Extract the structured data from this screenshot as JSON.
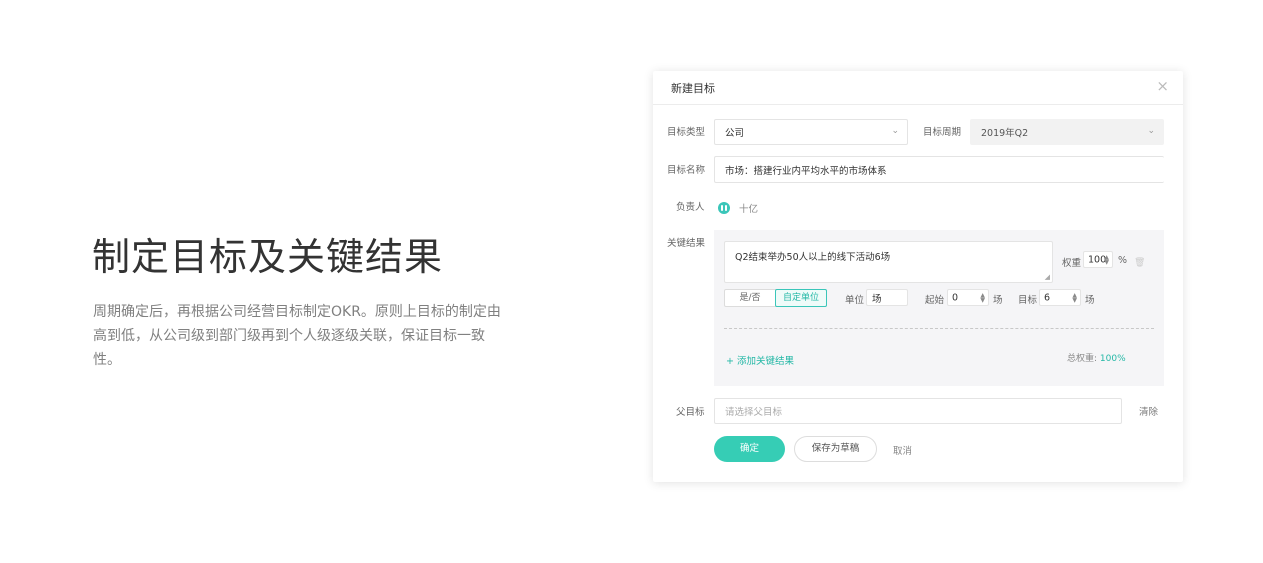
{
  "hero": {
    "title": "制定目标及关键结果",
    "description": "周期确定后，再根据公司经营目标制定OKR。原则上目标的制定由高到低，从公司级到部门级再到个人级逐级关联，保证目标一致性。"
  },
  "dialog": {
    "title": "新建目标",
    "close_icon": "close-icon",
    "target_type": {
      "label": "目标类型",
      "value": "公司"
    },
    "period": {
      "label": "目标周期",
      "value": "2019年Q2"
    },
    "name": {
      "label": "目标名称",
      "value": "市场：搭建行业内平均水平的市场体系"
    },
    "owner": {
      "label": "负责人",
      "add_text": "十亿"
    },
    "key_results": {
      "label": "关键结果",
      "item_text": "Q2结束举办50人以上的线下活动6场",
      "weight_label": "权重",
      "weight_value": "100",
      "percent": "%",
      "seg_yes_no": "是/否",
      "seg_custom": "自定单位",
      "unit_label": "单位",
      "unit_value": "场",
      "start_label": "起始",
      "start_value": "0",
      "start_unit": "场",
      "target_label": "目标",
      "target_value": "6",
      "target_unit": "场",
      "add_label": "+ 添加关键结果",
      "total_label": "总权重:",
      "total_value": "100%"
    },
    "parent": {
      "label": "父目标",
      "placeholder": "请选择父目标",
      "clear": "清除"
    },
    "buttons": {
      "confirm": "确定",
      "draft": "保存为草稿",
      "cancel": "取消"
    }
  }
}
